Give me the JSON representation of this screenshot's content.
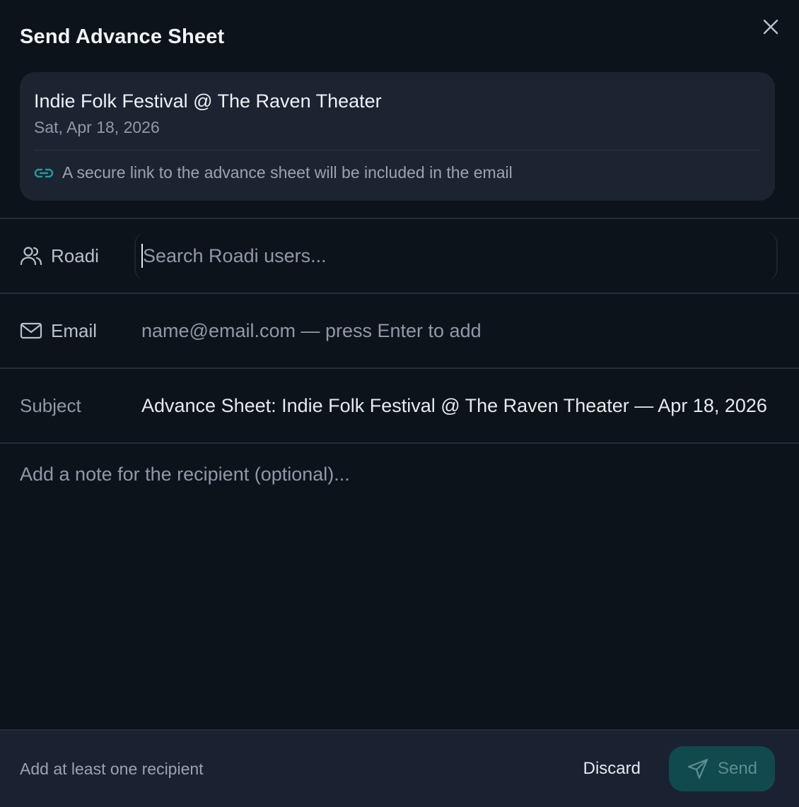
{
  "dialog": {
    "title": "Send Advance Sheet",
    "close_icon": "close-icon"
  },
  "event": {
    "name": "Indie Folk Festival @ The Raven Theater",
    "date": "Sat, Apr 18, 2026",
    "link_note": "A secure link to the advance sheet will be included in the email",
    "link_icon": "link-icon"
  },
  "fields": {
    "roadi": {
      "label": "Roadi",
      "icon": "users-icon",
      "placeholder": "Search Roadi users..."
    },
    "email": {
      "label": "Email",
      "icon": "mail-icon",
      "placeholder": "name@email.com — press Enter to add"
    },
    "subject": {
      "label": "Subject",
      "value": "Advance Sheet: Indie Folk Festival @ The Raven Theater — Apr 18, 2026"
    },
    "note": {
      "placeholder": "Add a note for the recipient (optional)..."
    }
  },
  "footer": {
    "hint": "Add at least one recipient",
    "discard_label": "Discard",
    "send_label": "Send",
    "send_icon": "send-icon"
  },
  "colors": {
    "background": "#0d131b",
    "card": "#1c2432",
    "accent": "#1f9e9a",
    "send_button": "#114a4e"
  }
}
